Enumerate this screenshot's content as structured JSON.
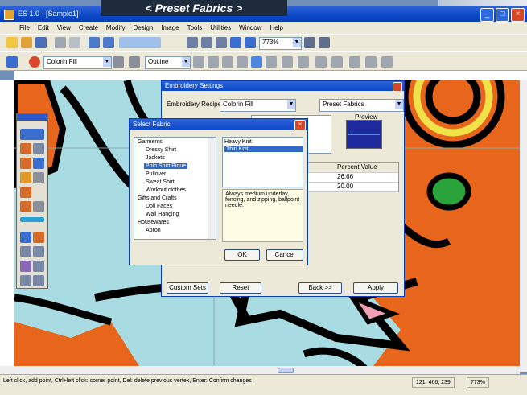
{
  "banner": {
    "text": "< Preset Fabrics >"
  },
  "window": {
    "title": "ES 1.0 - [Sample1]"
  },
  "menu": [
    "File",
    "Edit",
    "View",
    "Create",
    "Modify",
    "Design",
    "Image",
    "Tools",
    "Utilities",
    "Window",
    "Help"
  ],
  "toolbar": {
    "zoom_value": "773%",
    "fill_value": "Colorin Fill",
    "outline_value": "Outline"
  },
  "settings_dialog": {
    "title": "Embroidery Settings",
    "recipe_label": "Embroidery Recipe:",
    "recipe_value": "Colorin Fill",
    "preset_value": "Preset Fabrics",
    "preview_label": "Preview",
    "grid_header": "Percent Value",
    "grid_values": [
      "26.66",
      "20.00"
    ],
    "buttons": [
      "Custom Sets",
      "Reset",
      "Back >>",
      "Apply"
    ]
  },
  "fabric_dialog": {
    "title": "Select Fabric",
    "tree": [
      {
        "label": "Garments",
        "level": 0,
        "selected": false
      },
      {
        "label": "Dressy Shirt",
        "level": 1,
        "selected": false
      },
      {
        "label": "Jackets",
        "level": 1,
        "selected": false
      },
      {
        "label": "Polo Shirt Pique",
        "level": 1,
        "selected": true
      },
      {
        "label": "Pullover",
        "level": 1,
        "selected": false
      },
      {
        "label": "Sweat Shirt",
        "level": 1,
        "selected": false
      },
      {
        "label": "Workout clothes",
        "level": 1,
        "selected": false
      },
      {
        "label": "Gifts and Crafts",
        "level": 0,
        "selected": false
      },
      {
        "label": "Doll Faces",
        "level": 1,
        "selected": false
      },
      {
        "label": "Wall Hanging",
        "level": 1,
        "selected": false
      },
      {
        "label": "Housewares",
        "level": 0,
        "selected": false
      },
      {
        "label": "Apron",
        "level": 1,
        "selected": false
      }
    ],
    "fabrics": [
      {
        "label": "Heavy Knit",
        "selected": false
      },
      {
        "label": "Thin Knit",
        "selected": true
      }
    ],
    "description": "Always medium underlay, fencing, and zipping, ballpoint needle.",
    "ok_label": "OK",
    "cancel_label": "Cancel"
  },
  "status": {
    "text": "Left click, add point, Ctrl+left click: corner point, Del: delete previous vertex, Enter: Confirm changes",
    "coords": "121, 466, 239",
    "zoom": "773%"
  },
  "colors": {
    "canvas_blue": "#a9dbe3",
    "orange": "#e8651c",
    "outline": "#000000",
    "selection": "#316ac5",
    "titlebar": "#0b47c7"
  }
}
